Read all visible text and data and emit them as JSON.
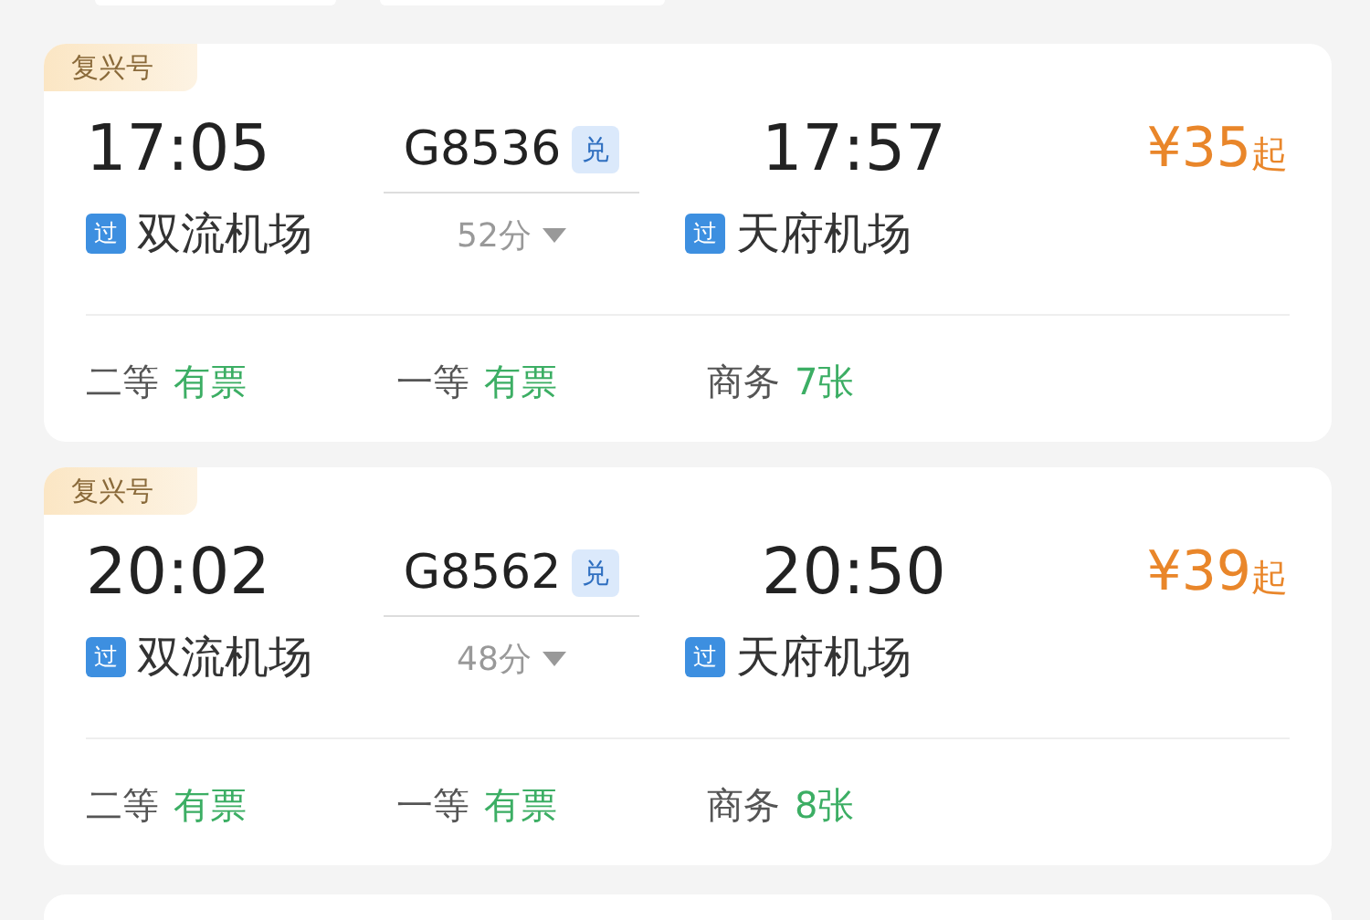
{
  "trains": [
    {
      "brand": "复兴号",
      "depart_time": "17:05",
      "train_no": "G8536",
      "exchange_tag": "兑",
      "arrive_time": "17:57",
      "depart_station": "双流机场",
      "depart_tag": "过",
      "duration": "52分",
      "arrive_station": "天府机场",
      "arrive_tag": "过",
      "price": "¥35",
      "price_suffix": "起",
      "seats": [
        {
          "class": "二等",
          "availability": "有票"
        },
        {
          "class": "一等",
          "availability": "有票"
        },
        {
          "class": "商务",
          "availability": "7张"
        }
      ]
    },
    {
      "brand": "复兴号",
      "depart_time": "20:02",
      "train_no": "G8562",
      "exchange_tag": "兑",
      "arrive_time": "20:50",
      "depart_station": "双流机场",
      "depart_tag": "过",
      "duration": "48分",
      "arrive_station": "天府机场",
      "arrive_tag": "过",
      "price": "¥39",
      "price_suffix": "起",
      "seats": [
        {
          "class": "二等",
          "availability": "有票"
        },
        {
          "class": "一等",
          "availability": "有票"
        },
        {
          "class": "商务",
          "availability": "8张"
        }
      ]
    }
  ]
}
